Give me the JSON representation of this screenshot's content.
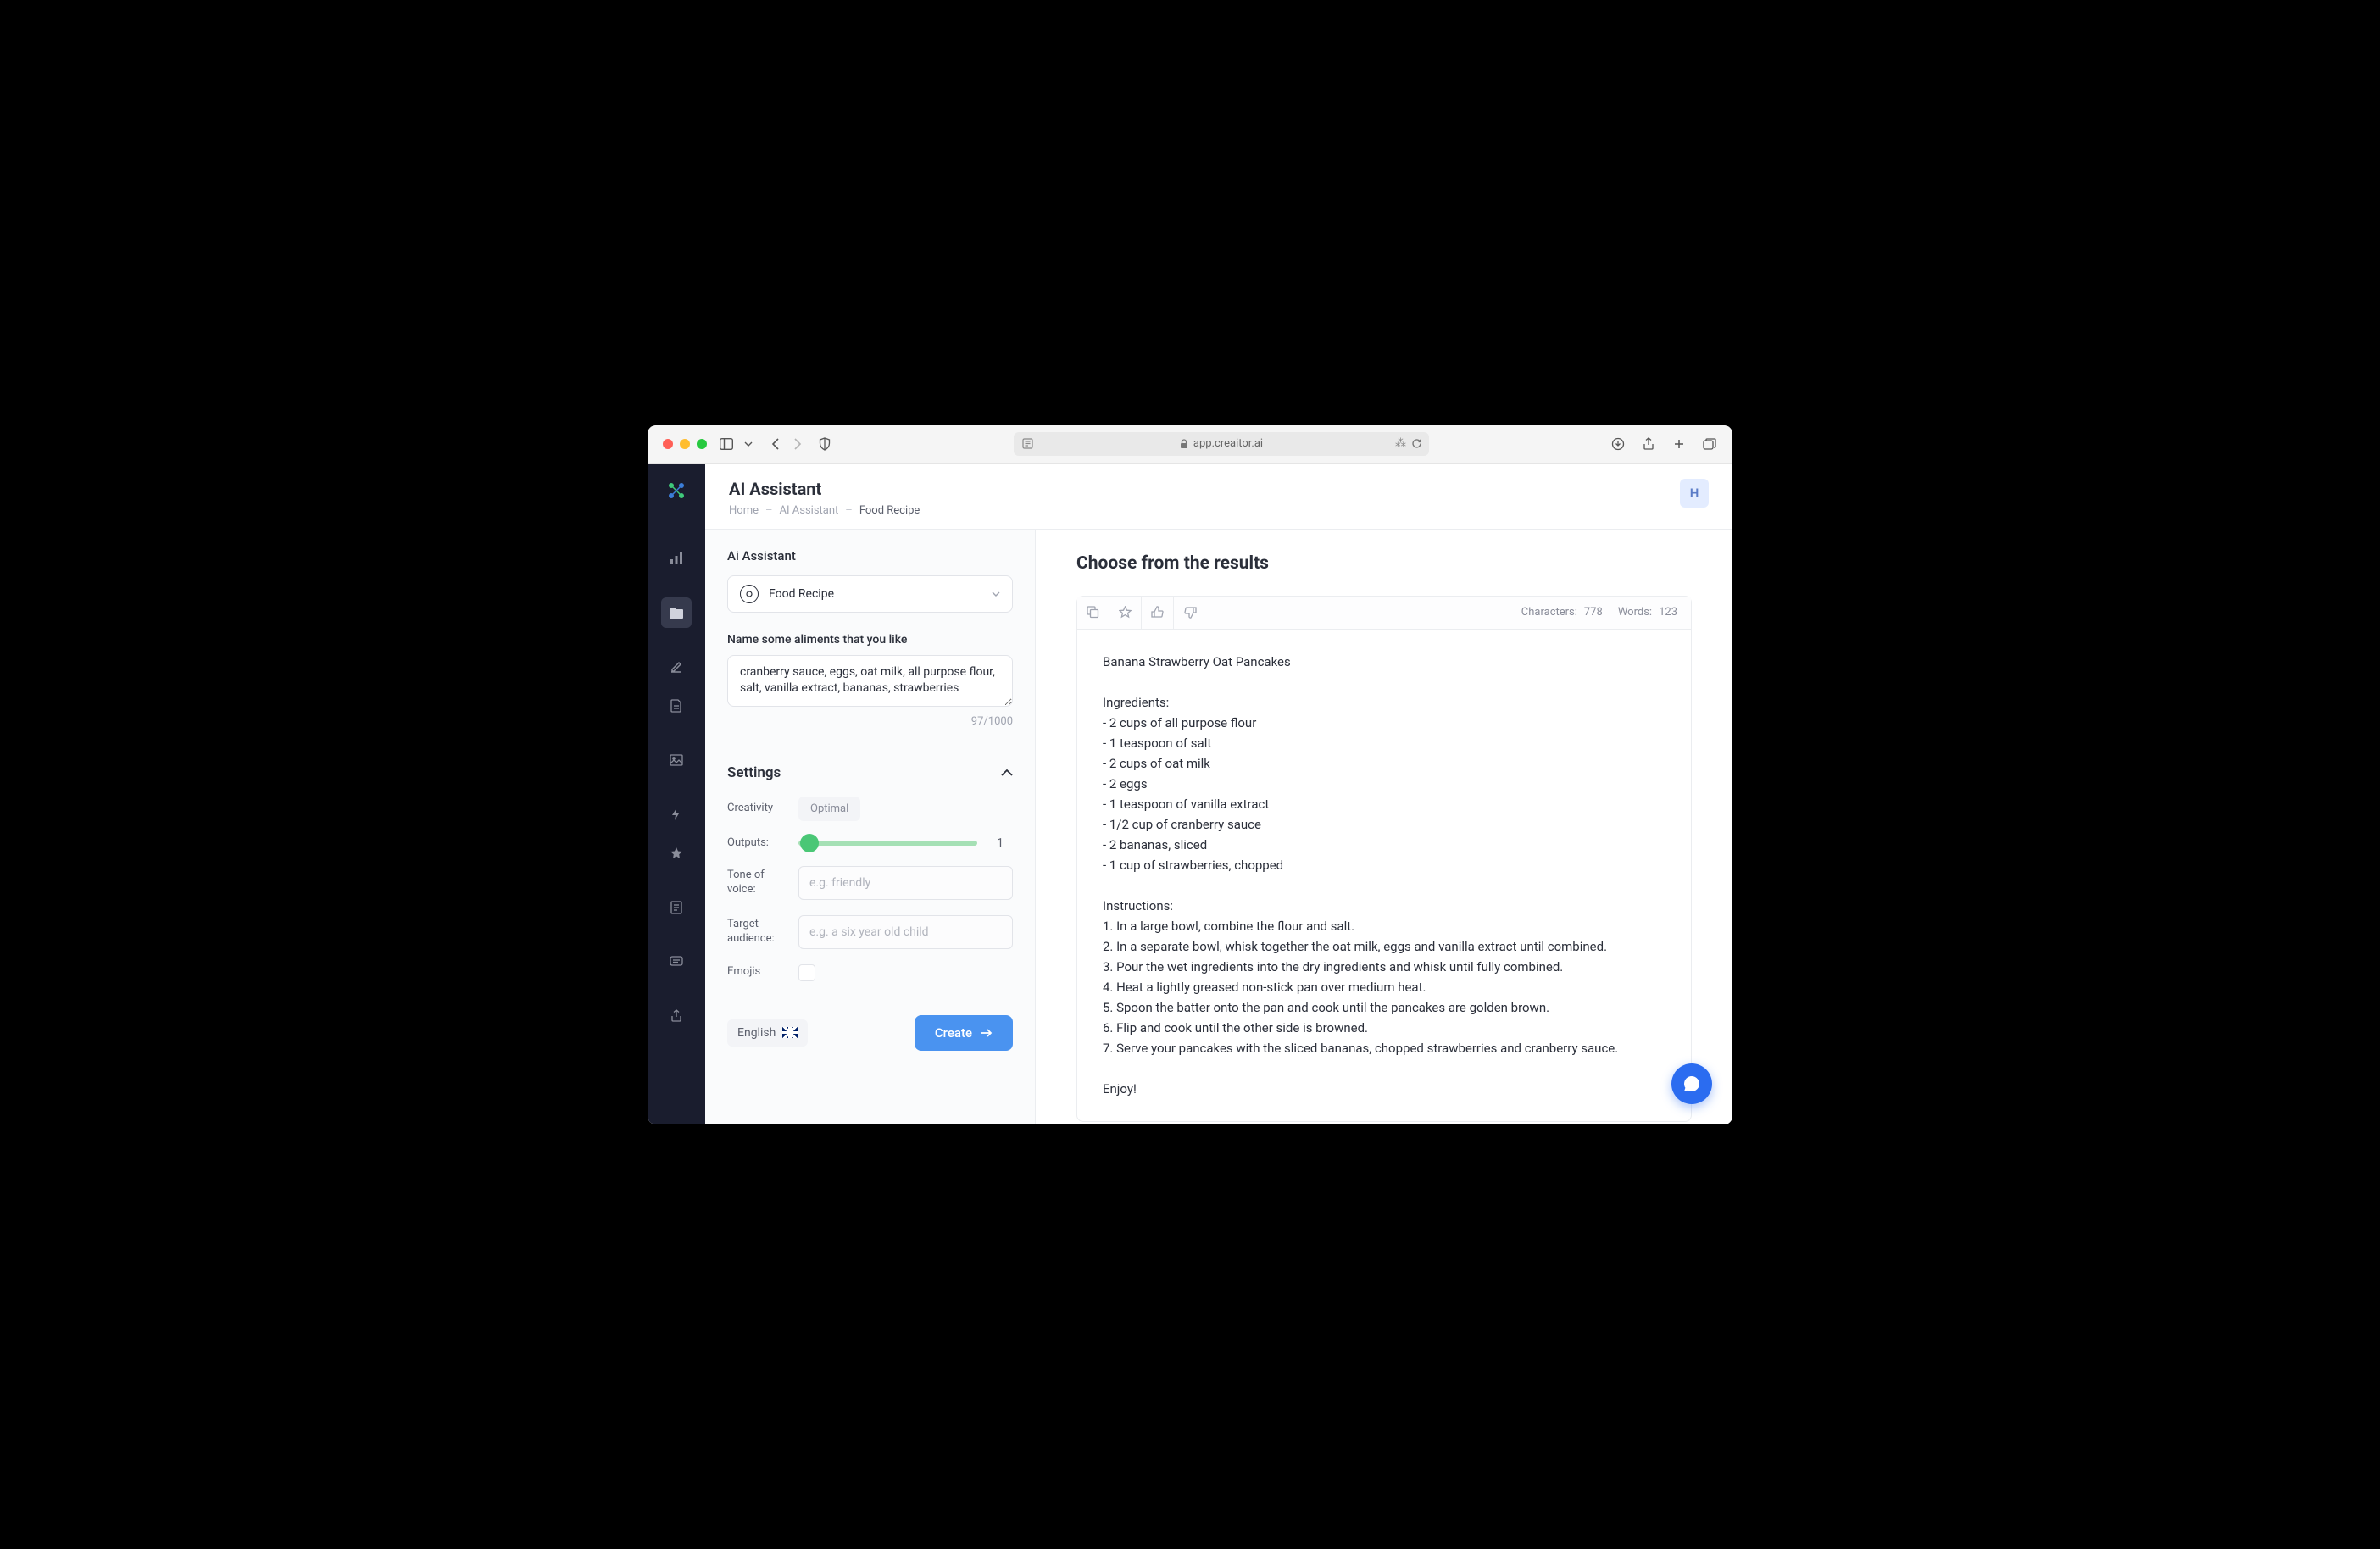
{
  "browser": {
    "url": "app.creaitor.ai"
  },
  "header": {
    "title": "AI Assistant",
    "breadcrumb": [
      "Home",
      "AI Assistant",
      "Food Recipe"
    ],
    "avatar_initial": "H"
  },
  "form": {
    "section_label": "Ai Assistant",
    "selected_template": "Food Recipe",
    "prompt_label": "Name some aliments that you like",
    "prompt_value": "cranberry sauce, eggs, oat milk, all purpose flour, salt, vanilla extract, bananas, strawberries",
    "char_count": "97/1000"
  },
  "settings": {
    "title": "Settings",
    "creativity_label": "Creativity",
    "creativity_value": "Optimal",
    "outputs_label": "Outputs:",
    "outputs_value": "1",
    "tone_label": "Tone of voice:",
    "tone_placeholder": "e.g. friendly",
    "audience_label": "Target audience:",
    "audience_placeholder": "e.g. a six year old child",
    "emojis_label": "Emojis"
  },
  "footer": {
    "language": "English",
    "create_button": "Create"
  },
  "results": {
    "title": "Choose from the results",
    "characters_label": "Characters:",
    "characters_value": "778",
    "words_label": "Words:",
    "words_value": "123",
    "body": "Banana Strawberry Oat Pancakes\n\nIngredients:\n- 2 cups of all purpose flour\n- 1 teaspoon of salt\n- 2 cups of oat milk\n- 2 eggs\n- 1 teaspoon of vanilla extract\n- 1/2 cup of cranberry sauce\n- 2 bananas, sliced\n- 1 cup of strawberries, chopped\n\nInstructions:\n1. In a large bowl, combine the flour and salt.\n2. In a separate bowl, whisk together the oat milk, eggs and vanilla extract until combined.\n3. Pour the wet ingredients into the dry ingredients and whisk until fully combined.\n4. Heat a lightly greased non-stick pan over medium heat.\n5. Spoon the batter onto the pan and cook until the pancakes are golden brown.\n6. Flip and cook until the other side is browned.\n7. Serve your pancakes with the sliced bananas, chopped strawberries and cranberry sauce.\n\nEnjoy!"
  }
}
